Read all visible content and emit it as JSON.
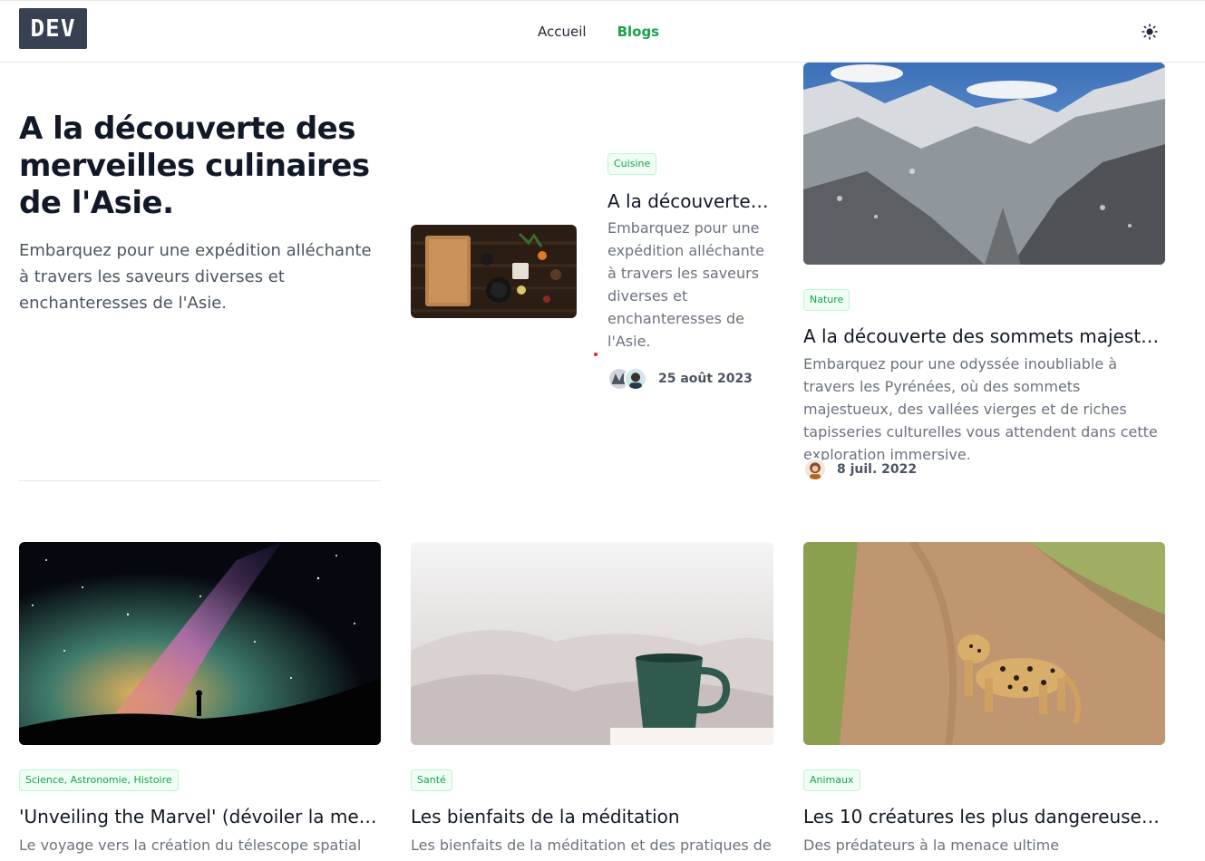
{
  "header": {
    "logo": "DEV",
    "nav": [
      {
        "label": "Accueil"
      },
      {
        "label": "Blogs"
      }
    ],
    "theme_icon": "sun-icon"
  },
  "hero": {
    "title": "A la découverte des merveilles culinaires de l'Asie.",
    "description": "Embarquez pour une expédition alléchante à travers les saveurs diverses et enchanteresses de l'Asie."
  },
  "featured": {
    "badge": "Cuisine",
    "title": "A la découverte ...",
    "description": "Embarquez pour une expédition alléchante à travers les saveurs diverses et enchanteresses de l'Asie.",
    "date": "25 août 2023"
  },
  "nature_post": {
    "badge": "Nature",
    "title": "A la découverte des sommets majestue...",
    "description": "Embarquez pour une odyssée inoubliable à travers les Pyrénées, où des sommets majestueux, des vallées vierges et de riches tapisseries culturelles vous attendent dans cette exploration immersive.",
    "date": "8 juil. 2022"
  },
  "cards": [
    {
      "badge": "Science, Astronomie, Histoire",
      "title": "'Unveiling the Marvel' (dévoiler la merv...",
      "description": "Le voyage vers la création du télescope spatial"
    },
    {
      "badge": "Santé",
      "title": "Les bienfaits de la méditation",
      "description": "Les bienfaits de la méditation et des pratiques de"
    },
    {
      "badge": "Animaux",
      "title": "Les 10 créatures les plus dangereuses de...",
      "description": "Des prédateurs à la menace ultime"
    }
  ]
}
